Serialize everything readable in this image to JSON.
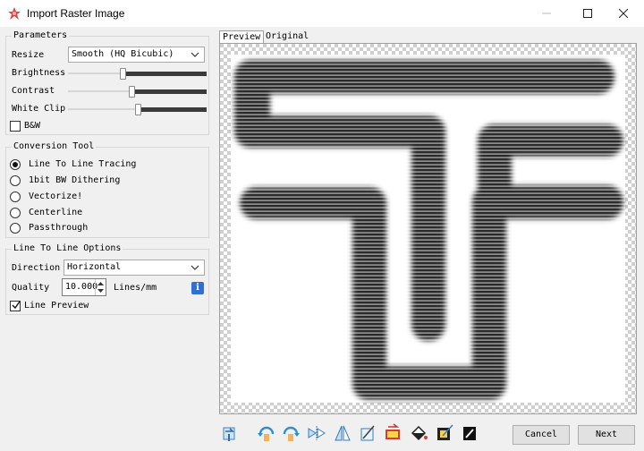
{
  "window": {
    "title": "Import Raster Image",
    "icon": "app-logo-icon",
    "controls": [
      "minimize-icon",
      "maximize-icon",
      "close-icon"
    ]
  },
  "parameters": {
    "title": "Parameters",
    "resize_label": "Resize",
    "resize_value": "Smooth (HQ Bicubic)",
    "brightness_label": "Brightness",
    "brightness_level": 0.39,
    "contrast_label": "Contrast",
    "contrast_level": 0.46,
    "white_clip_label": "White Clip",
    "white_clip_level": 0.51,
    "bw_label": "B&W",
    "bw_checked": false
  },
  "conversion_tool": {
    "title": "Conversion Tool",
    "options": [
      "Line To Line Tracing",
      "1bit BW Dithering",
      "Vectorize!",
      "Centerline",
      "Passthrough"
    ],
    "selected": "Line To Line Tracing"
  },
  "line_options": {
    "title": "Line To Line Options",
    "direction_label": "Direction",
    "direction_value": "Horizontal",
    "quality_label": "Quality",
    "quality_value": "10.000",
    "quality_unit": "Lines/mm",
    "line_preview_label": "Line Preview",
    "line_preview_checked": true
  },
  "tabs": {
    "preview": "Preview",
    "original": "Original",
    "active": "Preview"
  },
  "toolbar": {
    "icons": [
      "reset-icon",
      "rotate-left-icon",
      "rotate-right-icon",
      "flip-horizontal-icon",
      "flip-vertical-icon",
      "crop-icon",
      "invert-icon",
      "fill-bucket-icon",
      "select-area-icon",
      "line-color-icon"
    ]
  },
  "buttons": {
    "cancel": "Cancel",
    "next": "Next"
  },
  "colors": {
    "info_blue": "#2f6fd6",
    "slider_dark": "#3a3a3a",
    "window_bg": "#f0f0f0",
    "preview_ink": "#2b2b2b"
  }
}
